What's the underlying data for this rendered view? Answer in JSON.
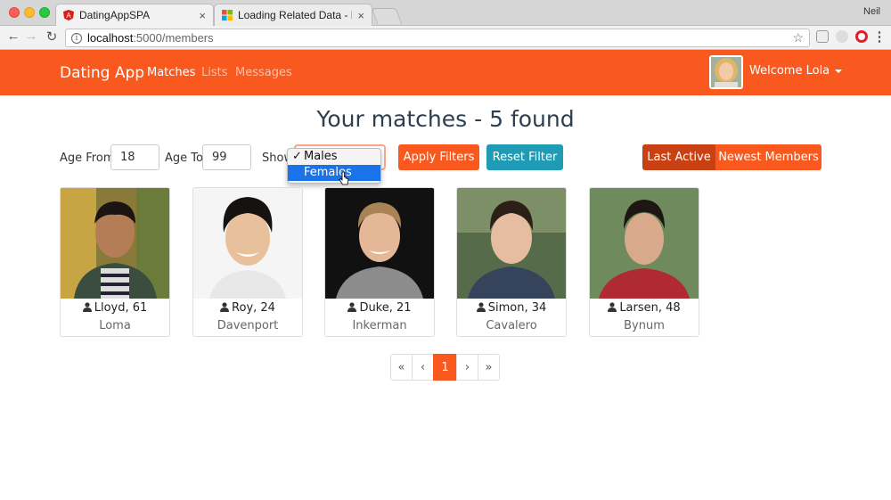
{
  "browser": {
    "tabs": [
      {
        "title": "DatingAppSPA",
        "active": true
      },
      {
        "title": "Loading Related Data - EF Cor",
        "active": false
      }
    ],
    "profile_name": "Neil",
    "url_host": "localhost",
    "url_path": ":5000/members"
  },
  "navbar": {
    "brand": "Dating App",
    "links": [
      "Matches",
      "Lists",
      "Messages"
    ],
    "welcome": "Welcome Lola"
  },
  "page": {
    "title": "Your matches - 5 found"
  },
  "filters": {
    "age_from_label": "Age From",
    "age_from_value": "18",
    "age_to_label": "Age To",
    "age_to_value": "99",
    "show_label": "Show",
    "gender_options": [
      "Males",
      "Females"
    ],
    "selected": "Males",
    "highlighted": "Females",
    "apply_label": "Apply Filters",
    "reset_label": "Reset Filter"
  },
  "sort": {
    "last_active": "Last Active",
    "newest": "Newest Members"
  },
  "members": [
    {
      "name_age": "Lloyd, 61",
      "city": "Loma"
    },
    {
      "name_age": "Roy, 24",
      "city": "Davenport"
    },
    {
      "name_age": "Duke, 21",
      "city": "Inkerman"
    },
    {
      "name_age": "Simon, 34",
      "city": "Cavalero"
    },
    {
      "name_age": "Larsen, 48",
      "city": "Bynum"
    }
  ],
  "pagination": {
    "first": "«",
    "prev": "‹",
    "current": "1",
    "next": "›",
    "last": "»"
  },
  "colors": {
    "primary": "#f9591f",
    "info": "#1f9bb5",
    "active_sort": "#c94012"
  }
}
